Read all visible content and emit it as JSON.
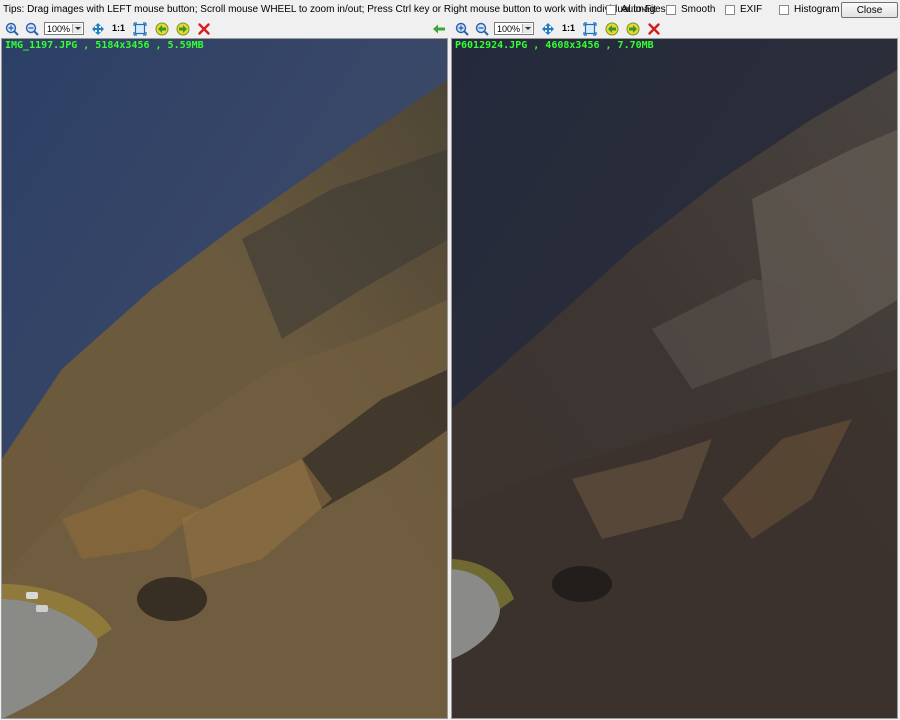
{
  "tips": "Tips: Drag images with LEFT mouse button; Scroll mouse WHEEL to zoom in/out; Press Ctrl key or Right mouse button to work with individual images.",
  "options": {
    "auto_fit": "Auto-Fit",
    "smooth": "Smooth",
    "exif": "EXIF",
    "histogram": "Histogram"
  },
  "close_label": "Close",
  "left": {
    "zoom": "100%",
    "one_to_one": "1:1",
    "caption": "IMG_1197.JPG , 5184x3456 , 5.59MB"
  },
  "right": {
    "zoom": "100%",
    "one_to_one": "1:1",
    "caption": "P6012924.JPG , 4608x3456 , 7.70MB"
  }
}
